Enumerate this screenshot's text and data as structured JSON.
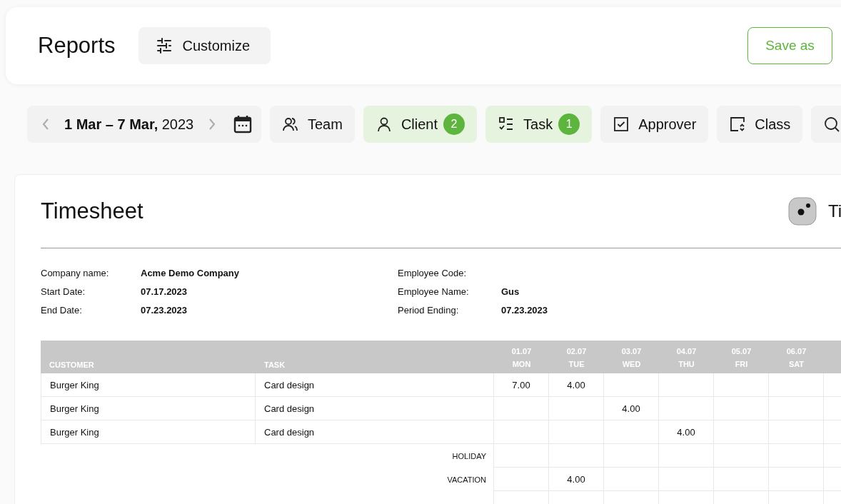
{
  "header": {
    "title": "Reports",
    "customize_button": "Customize",
    "save_button": "Save as"
  },
  "filters": {
    "date_range": "**1 Mar – 7 Mar,** 2023",
    "chips": [
      {
        "label": "Team",
        "active": false
      },
      {
        "label": "Client",
        "active": true,
        "count": "2"
      },
      {
        "label": "Task",
        "active": true,
        "count": "1"
      },
      {
        "label": "Approver",
        "active": false
      },
      {
        "label": "Class",
        "active": false
      },
      {
        "active": false
      }
    ]
  },
  "timesheet": {
    "title": "Timesheet",
    "toggle_label": "Ti",
    "info_left": [
      {
        "label": "Company name:",
        "value": "Acme Demo Company"
      },
      {
        "label": "Start Date:",
        "value": "07.17.2023"
      },
      {
        "label": "End Date:",
        "value": "07.23.2023"
      }
    ],
    "info_right": [
      {
        "label": "Employee Code:"
      },
      {
        "label": "Employee Name:",
        "value": "Gus"
      },
      {
        "label": "Period Ending:",
        "value": "07.23.2023"
      }
    ],
    "table": {
      "columns": [
        "CUSTOMER",
        "TASK"
      ],
      "days": [
        {
          "date": "01.07",
          "day": "MON"
        },
        {
          "date": "02.07",
          "day": "TUE"
        },
        {
          "date": "03.07",
          "day": "WED"
        },
        {
          "date": "04.07",
          "day": "THU"
        },
        {
          "date": "05.07",
          "day": "FRI"
        },
        {
          "date": "06.07",
          "day": "SAT"
        }
      ],
      "rows": [
        {
          "customer": "Burger King",
          "task": "Card design",
          "hours": {
            "0": "7.00",
            "1": "4.00"
          }
        },
        {
          "customer": "Burger King",
          "task": "Card design",
          "hours": {
            "2": "4.00"
          }
        },
        {
          "customer": "Burger King",
          "task": "Card design",
          "hours": {
            "3": "4.00"
          }
        }
      ],
      "extra_rows": [
        {
          "label": "HOLIDAY"
        },
        {
          "label": "VACATION",
          "hours": {
            "1": "4.00"
          }
        }
      ]
    }
  }
}
